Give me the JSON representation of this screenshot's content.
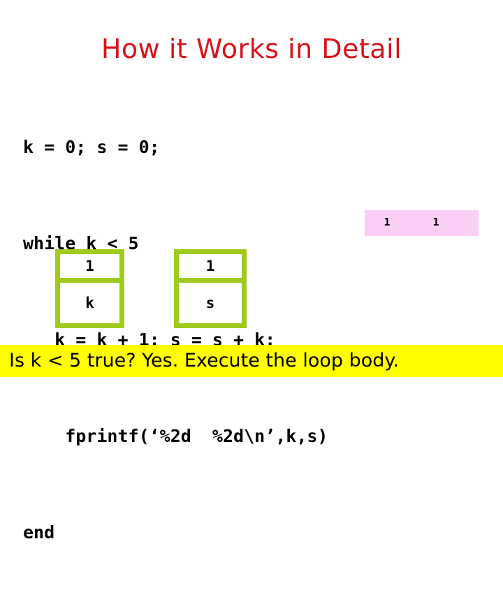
{
  "slide": {
    "title": "How it Works in Detail",
    "title_color": "#D5151A",
    "background_color": "#FFFFFF"
  },
  "code": {
    "language": "matlab",
    "lines": [
      "k = 0; s = 0;",
      "while k < 5",
      "   k = k + 1; s = s + k;",
      "    fprintf('%2d  %2d\\n',k,s)",
      "end"
    ],
    "line_0": "k = 0; s = 0;",
    "line_1": "while k < 5",
    "line_2": "   k = k + 1; s = s + k;",
    "line_3": "    fprintf(‘%2d  %2d\\n’,k,s)",
    "line_4": "end"
  },
  "output_box": {
    "background_color": "#FBCFF5",
    "cells": [
      "1",
      "1"
    ],
    "cell_0": "1",
    "cell_1": "1"
  },
  "variables": {
    "border_color": "#9ECB1E",
    "boxes": [
      {
        "value": "1",
        "name": "k"
      },
      {
        "value": "1",
        "name": "s"
      }
    ],
    "k_value": "1",
    "k_name": "k",
    "s_value": "1",
    "s_name": "s"
  },
  "banner": {
    "background_color": "#FFFF00",
    "text": "Is k < 5 true? Yes. Execute the loop body."
  }
}
